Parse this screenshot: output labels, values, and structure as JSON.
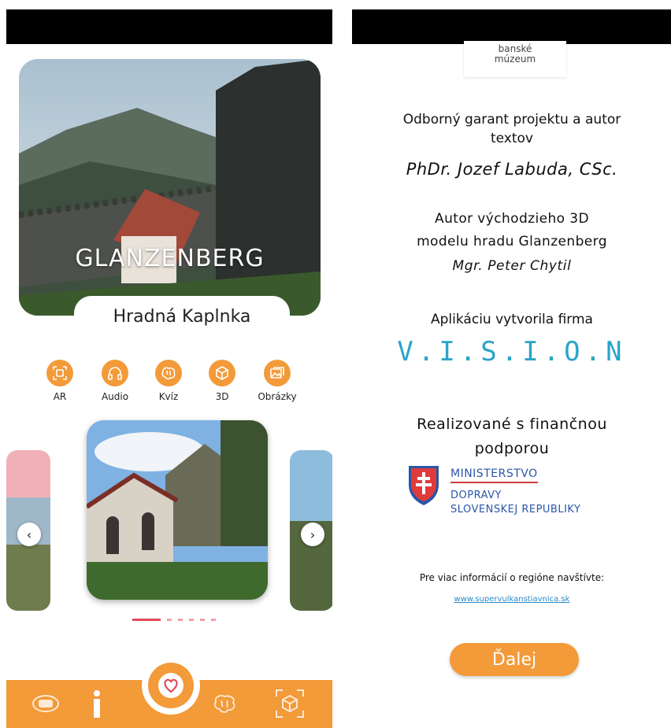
{
  "left_screen": {
    "hero": {
      "title": "GLANZENBERG",
      "subtitle": "Hradná Kaplnka"
    },
    "actions": [
      {
        "label": "AR",
        "icon": "ar-scan-icon"
      },
      {
        "label": "Audio",
        "icon": "headphones-icon"
      },
      {
        "label": "Kvíz",
        "icon": "brain-icon"
      },
      {
        "label": "3D",
        "icon": "cube-icon"
      },
      {
        "label": "Obrázky",
        "icon": "images-icon"
      }
    ],
    "carousel": {
      "prev_icon": "chevron-left-icon",
      "next_icon": "chevron-right-icon",
      "prev_glyph": "‹",
      "next_glyph": "›"
    },
    "bottom_nav": [
      {
        "icon": "map-icon"
      },
      {
        "icon": "info-icon"
      },
      {
        "icon": "heart-icon"
      },
      {
        "icon": "brain-icon"
      },
      {
        "icon": "ar-cube-icon"
      }
    ],
    "colors": {
      "accent": "#f39a39",
      "pager_active": "#e24a5a",
      "pager_inactive": "#f2a0a8"
    }
  },
  "right_screen": {
    "logo": {
      "line1": "banské",
      "line2": "múzeum"
    },
    "guarantor": {
      "label_line1": "Odborný garant projektu a autor",
      "label_line2": "textov",
      "name": "PhDr. Jozef Labuda, CSc."
    },
    "model_author": {
      "label_line1": "Autor východzieho 3D",
      "label_line2": "modelu hradu Glanzenberg",
      "name": "Mgr. Peter Chytil"
    },
    "created_by": {
      "label": "Aplikáciu vytvorila firma",
      "company": "V.I.S.I.O.N"
    },
    "funding": {
      "label_line1": "Realizované s finančnou",
      "label_line2": "podporou",
      "ministry_line1": "MINISTERSTVO",
      "ministry_line2": "DOPRAVY",
      "ministry_line3": "SLOVENSKEJ REPUBLIKY"
    },
    "more_info": {
      "label": "Pre viac informácií o regióne navštívte:",
      "link": "www.supervulkanstiavnica.sk"
    },
    "next_button": "Ďalej"
  }
}
